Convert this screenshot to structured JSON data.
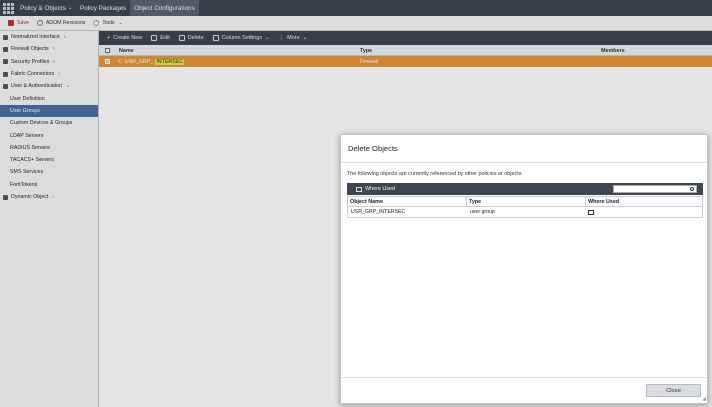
{
  "topbar": {
    "items": [
      {
        "label": "Policy & Objects",
        "chevron": true
      },
      {
        "label": "Policy Packages",
        "chevron": false
      },
      {
        "label": "Object Configurations",
        "chevron": false,
        "active": true
      }
    ]
  },
  "toolbar": {
    "save": "Save",
    "adom_revisions": "ADOM Revisions",
    "tools": "Tools"
  },
  "sidebar": {
    "items": [
      {
        "label": "Normalized Interface",
        "level": 0,
        "chevron": "›",
        "icon": "interface-icon"
      },
      {
        "label": "Firewall Objects",
        "level": 0,
        "chevron": "›",
        "icon": "firewall-icon"
      },
      {
        "label": "Security Profiles",
        "level": 0,
        "chevron": "›",
        "icon": "shield-icon"
      },
      {
        "label": "Fabric Connectors",
        "level": 0,
        "chevron": "›",
        "icon": "connector-icon"
      },
      {
        "label": "User & Authentication",
        "level": 0,
        "chevron": "⌄",
        "icon": "user-icon"
      },
      {
        "label": "User Definition",
        "level": 1
      },
      {
        "label": "User Groups",
        "level": 1,
        "active": true
      },
      {
        "label": "Custom Devices & Groups",
        "level": 1
      },
      {
        "label": "LDAP Servers",
        "level": 1
      },
      {
        "label": "RADIUS Servers",
        "level": 1
      },
      {
        "label": "TACACS+ Servers",
        "level": 1
      },
      {
        "label": "SMS Services",
        "level": 1
      },
      {
        "label": "FortiTokens",
        "level": 1
      },
      {
        "label": "Dynamic Object",
        "level": 0,
        "chevron": "›",
        "icon": "dynamic-icon"
      }
    ]
  },
  "actionbar": {
    "create_new": "Create New",
    "edit": "Edit",
    "delete": "Delete",
    "column_settings": "Column Settings",
    "more": "More"
  },
  "table": {
    "headers": {
      "name": "Name",
      "type": "Type",
      "members": "Members"
    },
    "row": {
      "name_prefix": "USR_GRP_",
      "name_highlight": "INTERSEC",
      "type": "Firewall"
    }
  },
  "dialog": {
    "title": "Delete Objects",
    "message": "The following objects are currently referenced by other policies or objects.",
    "where_used": "Where Used",
    "search_placeholder": "",
    "headers": {
      "object_name": "Object Name",
      "type": "Type",
      "where_used": "Where Used"
    },
    "rows": [
      {
        "object_name": "USR_GRP_INTERSEC",
        "type": "user group"
      }
    ],
    "close": "Close"
  },
  "colors": {
    "nav_dark": "#3d4751",
    "accent_selected": "#4a6fa5",
    "row_highlight": "#e8973a",
    "search_highlight": "#e5e83b",
    "save_red": "#c03030"
  }
}
